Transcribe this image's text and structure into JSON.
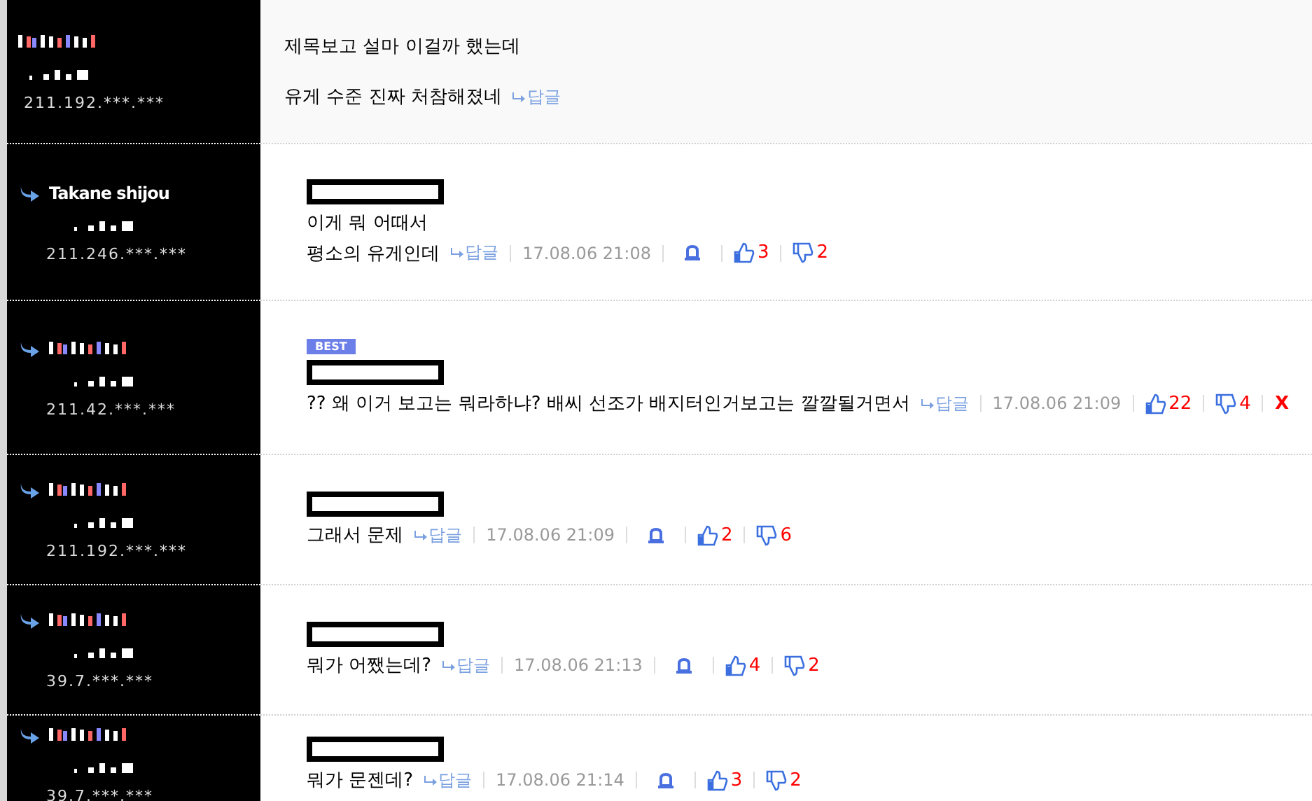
{
  "comments": [
    {
      "is_reply": false,
      "highlighted": true,
      "ip": "211.192.***.***",
      "quoted": false,
      "best": false,
      "lines": [
        "제목보고 설마 이걸까 했는데",
        "유게 수준 진짜 처참해졌네"
      ],
      "reply_label": "답글"
    },
    {
      "is_reply": true,
      "highlighted": false,
      "nickname": "Takane shijou",
      "ip": "211.246.***.***",
      "quoted": true,
      "best": false,
      "lines": [
        "이게 뭐 어때서",
        "평소의 유게인데"
      ],
      "reply_label": "답글",
      "date": "17.08.06 21:08",
      "report": true,
      "likes": "3",
      "dislikes": "2",
      "deletable": false
    },
    {
      "is_reply": true,
      "highlighted": false,
      "ip": "211.42.***.***",
      "quoted": true,
      "best": true,
      "best_label": "BEST",
      "lines": [
        "?? 왜 이거 보고는 뭐라하냐? 배씨 선조가 배지터인거보고는 깔깔될거면서"
      ],
      "reply_label": "답글",
      "date": "17.08.06 21:09",
      "report": false,
      "likes": "22",
      "dislikes": "4",
      "deletable": true,
      "delete_label": "X"
    },
    {
      "is_reply": true,
      "highlighted": false,
      "ip": "211.192.***.***",
      "quoted": true,
      "best": false,
      "lines": [
        "그래서 문제"
      ],
      "reply_label": "답글",
      "date": "17.08.06 21:09",
      "report": true,
      "likes": "2",
      "dislikes": "6",
      "deletable": false
    },
    {
      "is_reply": true,
      "highlighted": false,
      "ip": "39.7.***.***",
      "quoted": true,
      "best": false,
      "lines": [
        "뭐가 어쨌는데?"
      ],
      "reply_label": "답글",
      "date": "17.08.06 21:13",
      "report": true,
      "likes": "4",
      "dislikes": "2",
      "deletable": false
    },
    {
      "is_reply": true,
      "highlighted": false,
      "ip": "39.7.***.***",
      "quoted": true,
      "best": false,
      "lines": [
        "뭐가 문젠데?"
      ],
      "reply_label": "답글",
      "date": "17.08.06 21:14",
      "report": true,
      "likes": "3",
      "dislikes": "2",
      "deletable": false
    }
  ]
}
